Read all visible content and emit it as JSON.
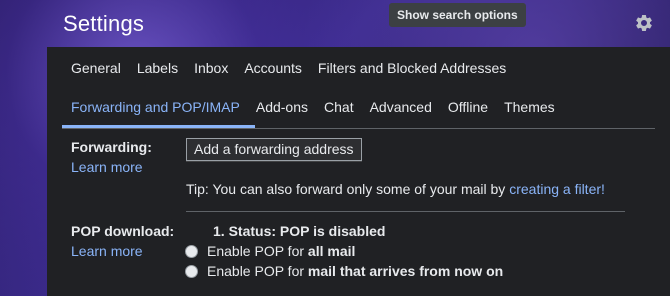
{
  "header": {
    "title": "Settings",
    "tooltip": "Show search options"
  },
  "tabs_row1": [
    "General",
    "Labels",
    "Inbox",
    "Accounts",
    "Filters and Blocked Addresses"
  ],
  "tabs_row2": [
    "Forwarding and POP/IMAP",
    "Add-ons",
    "Chat",
    "Advanced",
    "Offline",
    "Themes"
  ],
  "forwarding": {
    "label": "Forwarding:",
    "learn_more": "Learn more",
    "button": "Add a forwarding address",
    "tip_text": "Tip: You can also forward only some of your mail by ",
    "tip_link": "creating a filter!"
  },
  "pop": {
    "label": "POP download:",
    "learn_more": "Learn more",
    "status": "1. Status: POP is disabled",
    "option1_prefix": "Enable POP for ",
    "option1_bold": "all mail",
    "option2_prefix": "Enable POP for ",
    "option2_bold": "mail that arrives from now on"
  },
  "colors": {
    "accent": "#8ab4f8",
    "panel": "#202124"
  }
}
